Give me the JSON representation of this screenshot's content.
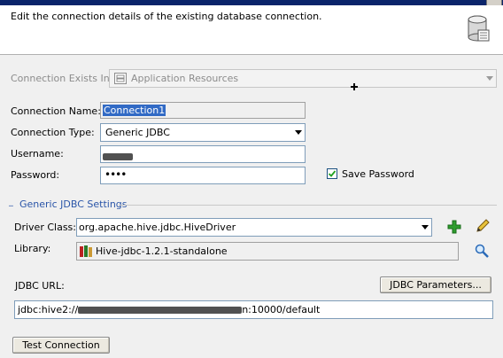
{
  "header": {
    "description": "Edit the connection details of the existing database connection."
  },
  "connection_exists_in": {
    "label": "Connection Exists In:",
    "value": "Application Resources"
  },
  "connection_name": {
    "label": "Connection Name:",
    "value": "Connection1"
  },
  "connection_type": {
    "label": "Connection Type:",
    "value": "Generic JDBC"
  },
  "username": {
    "label": "Username:"
  },
  "password": {
    "label": "Password:",
    "value": "••••"
  },
  "save_password": {
    "label": "Save Password",
    "checked": true
  },
  "generic_jdbc": {
    "section_title": "Generic JDBC Settings",
    "driver_class_label": "Driver Class:",
    "driver_class_value": "org.apache.hive.jdbc.HiveDriver",
    "library_label": "Library:",
    "library_value": "Hive-jdbc-1.2.1-standalone"
  },
  "jdbc_url": {
    "label": "JDBC URL:",
    "parameters_button": "JDBC Parameters...",
    "value_prefix": "jdbc:hive2://",
    "value_suffix": "n:10000/default"
  },
  "test_connection_button": "Test Connection",
  "icons": {
    "add": "add-icon",
    "edit": "pencil-icon",
    "browse": "search-icon",
    "library": "library-icon",
    "database": "database-icon",
    "app_resources": "application-resources-icon"
  },
  "colors": {
    "add_green": "#2e9d2e",
    "selection_blue": "#316ac5"
  }
}
